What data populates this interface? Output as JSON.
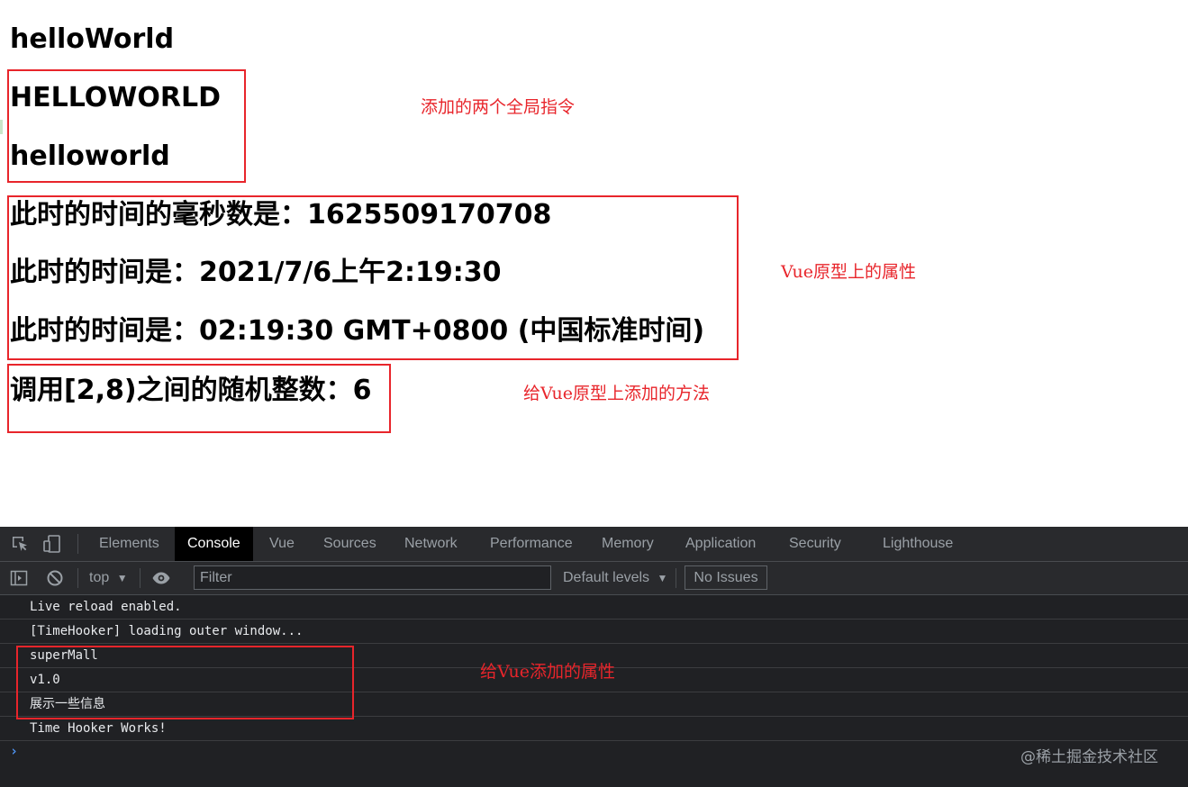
{
  "page": {
    "headings": [
      "helloWorld",
      "HELLOWORLD",
      "helloworld",
      "此时的时间的毫秒数是：1625509170708",
      "此时的时间是：2021/7/6上午2:19:30",
      "此时的时间是：02:19:30 GMT+0800 (中国标准时间)",
      "调用[2,8)之间的随机整数：6"
    ],
    "annotations": {
      "directives": "添加的两个全局指令",
      "prototype_props": "Vue原型上的属性",
      "prototype_method": "给Vue原型上添加的方法",
      "vue_props": "给Vue添加的属性"
    },
    "accent_color": "#e8252b"
  },
  "devtools": {
    "tabs": [
      "Elements",
      "Console",
      "Vue",
      "Sources",
      "Network",
      "Performance",
      "Memory",
      "Application",
      "Security",
      "Lighthouse"
    ],
    "active_tab": "Console",
    "toolbar": {
      "context": "top",
      "filter_placeholder": "Filter",
      "levels": "Default levels",
      "issues": "No Issues"
    },
    "console_lines": [
      "Live reload enabled.",
      "[TimeHooker] loading outer window...",
      "superMall",
      "v1.0",
      "展示一些信息",
      "Time Hooker Works!"
    ],
    "prompt": "›",
    "watermark": "@稀土掘金技术社区"
  }
}
